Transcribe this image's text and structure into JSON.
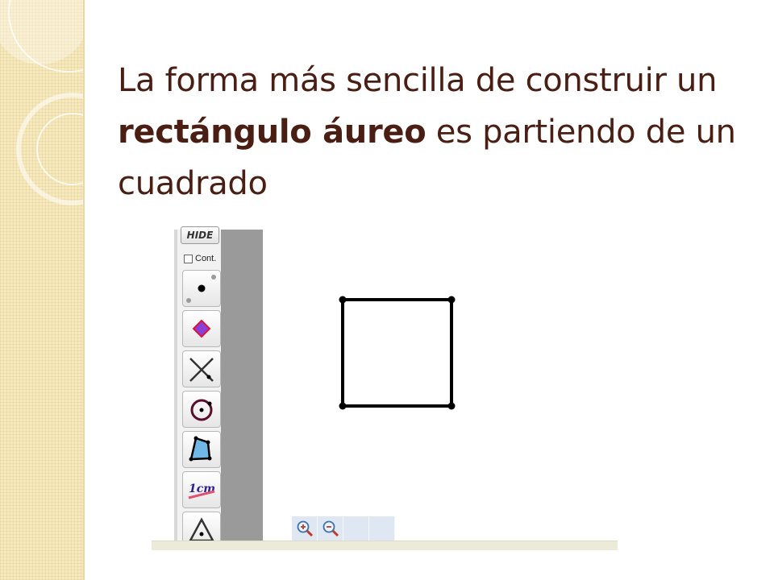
{
  "slide": {
    "title_part1": "La forma más sencilla de construir un ",
    "title_bold": "rectángulo áureo",
    "title_part2": " es partiendo de un cuadrado"
  },
  "app": {
    "hide_label": "HIDE",
    "cont_label": "Cont.",
    "tools": [
      {
        "name": "point-tool",
        "icon": "point-icon"
      },
      {
        "name": "polygon-point-tool",
        "icon": "diamond-point-icon"
      },
      {
        "name": "line-tool",
        "icon": "line-cross-icon"
      },
      {
        "name": "circle-tool",
        "icon": "circle-icon"
      },
      {
        "name": "polygon-tool",
        "icon": "polygon-icon"
      },
      {
        "name": "measure-tool",
        "icon": "measure-cm-icon",
        "label": "1cm"
      },
      {
        "name": "angle-tool",
        "icon": "triangle-icon"
      }
    ],
    "zoom_buttons": [
      "zoom-in-icon",
      "zoom-out-icon",
      "blank",
      "blank"
    ]
  },
  "colors": {
    "title": "#4a1e12",
    "strip": "#f6e9bd",
    "toolbar_gray": "#9a9a9a",
    "square_stroke": "#000000"
  }
}
